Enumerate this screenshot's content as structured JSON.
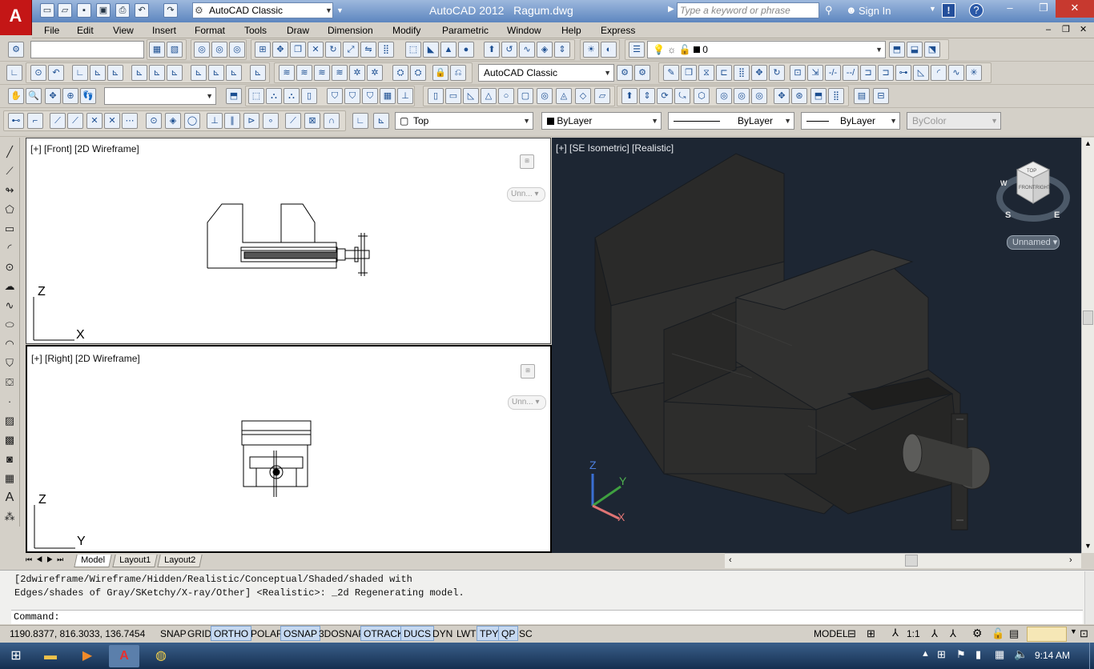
{
  "titlebar": {
    "app_title": "AutoCAD 2012",
    "file_name": "Ragum.dwg",
    "workspace": "AutoCAD Classic",
    "search_placeholder": "Type a keyword or phrase",
    "sign_in": "Sign In",
    "help": "?"
  },
  "menu": [
    "File",
    "Edit",
    "View",
    "Insert",
    "Format",
    "Tools",
    "Draw",
    "Dimension",
    "Modify",
    "Parametric",
    "Window",
    "Help",
    "Express"
  ],
  "toolbars": {
    "layer_current": "0",
    "workspace_combo": "AutoCAD Classic",
    "view_combo": "Top",
    "color_combo": "ByLayer",
    "linetype_combo": "ByLayer",
    "lineweight_combo": "ByLayer",
    "plotstyle_combo": "ByColor"
  },
  "viewports": {
    "front_label": "[+] [Front] [2D Wireframe]",
    "right_label": "[+] [Right] [2D Wireframe]",
    "iso_label": "[+] [SE Isometric] [Realistic]",
    "front_unnamed": "Unn...",
    "right_unnamed": "Unn...",
    "iso_unnamed": "Unnamed",
    "front_axis_y": "Z",
    "front_axis_x": "X",
    "right_axis_y": "Z",
    "right_axis_x": "Y",
    "iso_axis_z": "Z",
    "iso_axis_y": "Y",
    "iso_axis_x": "X",
    "viewcube_top": "TOP",
    "viewcube_front": "FRONT",
    "viewcube_right": "RIGHT",
    "compass_s": "S",
    "compass_e": "E",
    "compass_w": "W"
  },
  "tabs": [
    "Model",
    "Layout1",
    "Layout2"
  ],
  "command": {
    "line1": "[2dwireframe/Wireframe/Hidden/Realistic/Conceptual/Shaded/shaded with",
    "line2": "Edges/shades of Gray/SKetchy/X-ray/Other] <Realistic>: _2d Regenerating model.",
    "prompt": "Command:"
  },
  "status": {
    "coords": "1190.8377, 816.3033, 136.7454",
    "buttons": [
      {
        "label": "SNAP",
        "on": false
      },
      {
        "label": "GRID",
        "on": false
      },
      {
        "label": "ORTHO",
        "on": true
      },
      {
        "label": "POLAR",
        "on": false
      },
      {
        "label": "OSNAP",
        "on": true
      },
      {
        "label": "3DOSNAP",
        "on": false
      },
      {
        "label": "OTRACK",
        "on": true
      },
      {
        "label": "DUCS",
        "on": true
      },
      {
        "label": "DYN",
        "on": false
      },
      {
        "label": "LWT",
        "on": false
      },
      {
        "label": "TPY",
        "on": true
      },
      {
        "label": "QP",
        "on": true
      },
      {
        "label": "SC",
        "on": false
      }
    ],
    "model": "MODEL",
    "scale": "1:1"
  },
  "taskbar": {
    "clock": "9:14 AM"
  }
}
